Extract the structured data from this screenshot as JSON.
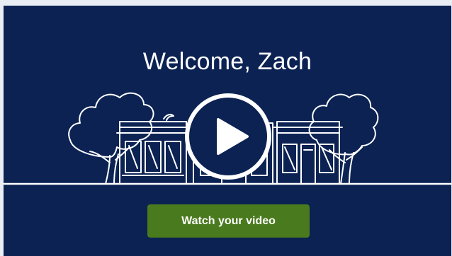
{
  "video": {
    "welcome_title": "Welcome, Zach",
    "play_icon": "play-icon",
    "cta_label": "Watch your video"
  },
  "colors": {
    "background": "#0b2253",
    "line_art": "#ffffff",
    "cta": "#4a7a1e",
    "page": "#e9edf4"
  }
}
